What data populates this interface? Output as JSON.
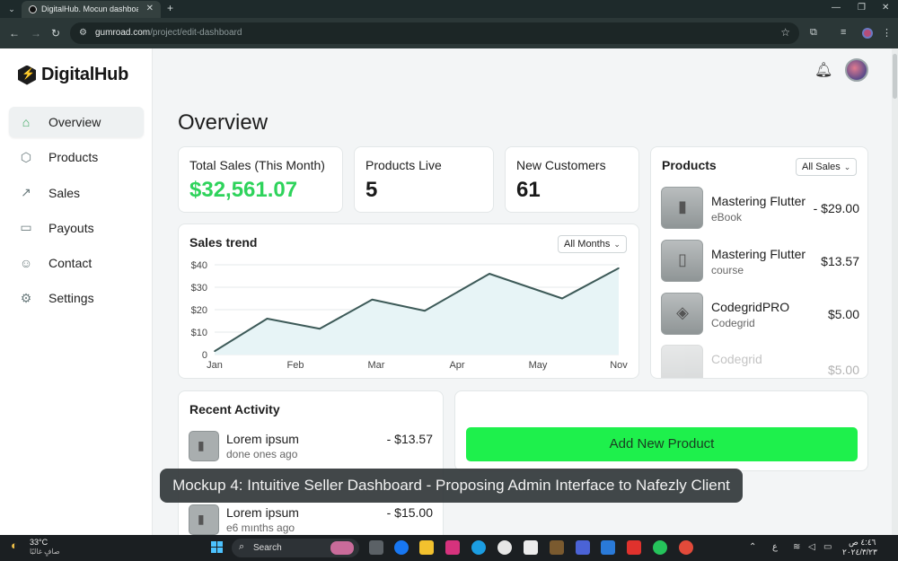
{
  "browser": {
    "tab_title": "DigitalHub. Mocun dashboard",
    "url_host": "gumroad.com",
    "url_path": "/project/edit-dashboard"
  },
  "sidebar": {
    "logo": "DigitalHub",
    "items": [
      {
        "label": "Overview",
        "icon": "home-icon"
      },
      {
        "label": "Products",
        "icon": "box-icon"
      },
      {
        "label": "Sales",
        "icon": "trend-icon"
      },
      {
        "label": "Payouts",
        "icon": "card-icon"
      },
      {
        "label": "Contact",
        "icon": "user-icon"
      },
      {
        "label": "Settings",
        "icon": "gear-icon"
      }
    ]
  },
  "main": {
    "title": "Overview",
    "stats": [
      {
        "label": "Total Sales (This Month)",
        "value": "$32,561.07"
      },
      {
        "label": "Products Live",
        "value": "5"
      },
      {
        "label": "New Customers",
        "value": "61"
      }
    ]
  },
  "sales_trend": {
    "title": "Sales trend",
    "filter": "All Months"
  },
  "chart_data": {
    "type": "area",
    "title": "Sales trend",
    "categories": [
      "Jan",
      "",
      "Feb",
      "",
      "Mar",
      "",
      "Apr",
      "",
      "May",
      "",
      "Nov"
    ],
    "x_tick_labels": [
      "Jan",
      "Feb",
      "Mar",
      "Apr",
      "May",
      "Nov"
    ],
    "y_tick_labels": [
      "$40",
      "$30",
      "$20",
      "$10",
      "0"
    ],
    "values": [
      1.5,
      16,
      11.5,
      24.5,
      19.5,
      36,
      25,
      38.5
    ],
    "x_positions": [
      0,
      0.65,
      1.3,
      1.95,
      2.6,
      3.4,
      4.3,
      5.0
    ],
    "ylim": [
      0,
      40
    ],
    "grid": true,
    "line_color": "#3d5a58",
    "fill_color": "#e7f4f6"
  },
  "products_panel": {
    "title": "Products",
    "filter": "All Sales",
    "items": [
      {
        "name": "Mastering Flutter",
        "sub": "eBook",
        "price": "- $29.00"
      },
      {
        "name": "Mastering Flutter",
        "sub": "course",
        "price": "$13.57"
      },
      {
        "name": "CodegridPRO",
        "sub": "Codegrid",
        "price": "$5.00"
      },
      {
        "name": "Codegrid",
        "sub": "",
        "price": "$5.00"
      }
    ]
  },
  "activity": {
    "title": "Recent Activity",
    "items": [
      {
        "title": "Lorem ipsum",
        "sub": "done ones ago",
        "amount": "- $13.57"
      },
      {
        "title": "Lorem ipsum",
        "sub": "e6 mınths ago",
        "amount": "- $15.00"
      }
    ]
  },
  "actions": {
    "add_product": "Add New Product"
  },
  "caption": "Mockup 4: Intuitive Seller Dashboard - Proposing Admin Interface to Nafezly Client",
  "taskbar": {
    "weather_temp": "33°C",
    "weather_desc": "صافٍ غالبًا",
    "search": "Search",
    "time": "٤:٤٦ ص",
    "date": "٢٠٢٤/٣/٢٣"
  },
  "colors": {
    "accent": "#1ef04c",
    "sales_value": "#2ed35b",
    "chart_line": "#3d5a58"
  }
}
